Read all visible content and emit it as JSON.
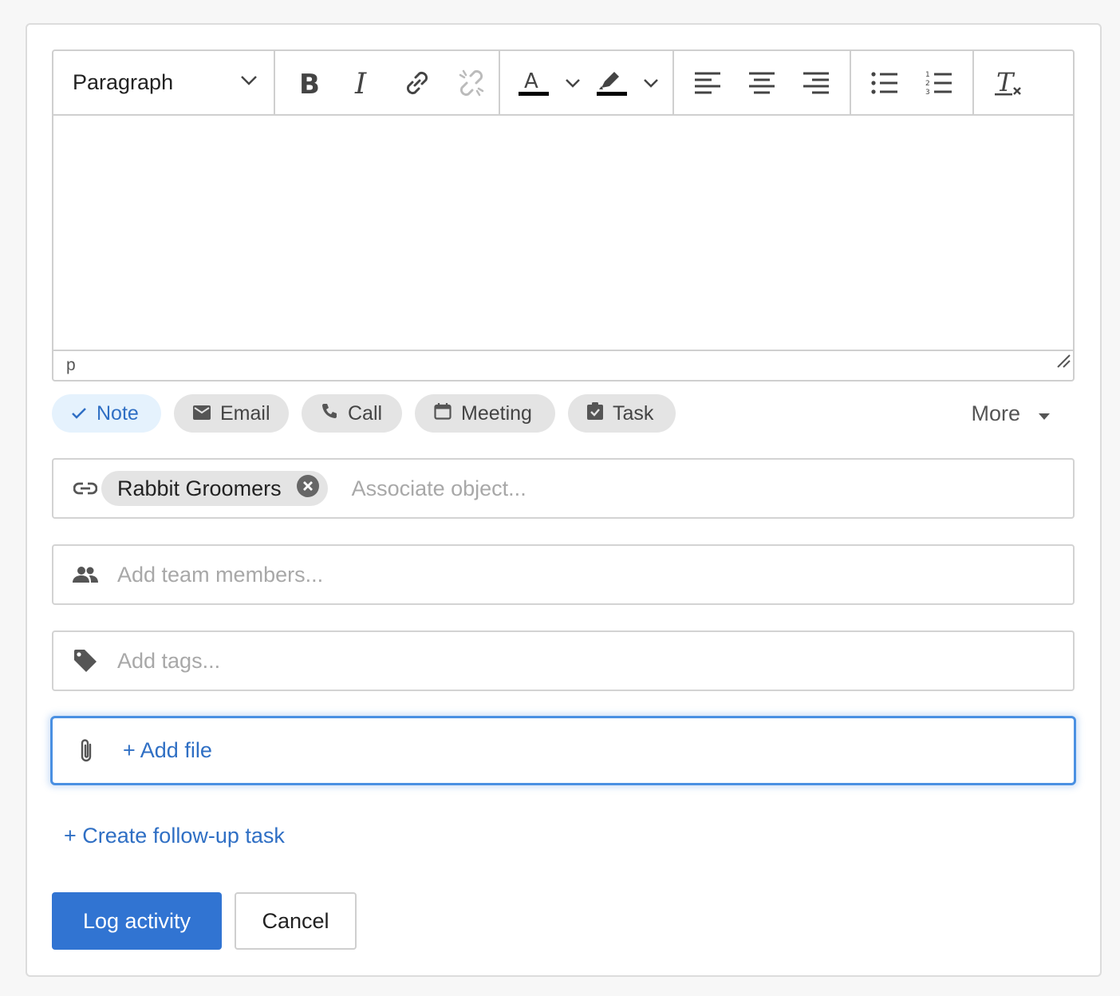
{
  "editor": {
    "block_format": "Paragraph",
    "status_path": "p",
    "content": ""
  },
  "activity_types": {
    "items": [
      {
        "label": "Note",
        "icon": "check-icon",
        "active": true
      },
      {
        "label": "Email",
        "icon": "envelope-icon",
        "active": false
      },
      {
        "label": "Call",
        "icon": "phone-icon",
        "active": false
      },
      {
        "label": "Meeting",
        "icon": "calendar-icon",
        "active": false
      },
      {
        "label": "Task",
        "icon": "clipboard-check-icon",
        "active": false
      }
    ],
    "more_label": "More"
  },
  "associations": {
    "chip_label": "Rabbit Groomers",
    "placeholder": "Associate object..."
  },
  "team": {
    "placeholder": "Add team members..."
  },
  "tags": {
    "placeholder": "Add tags..."
  },
  "files": {
    "add_label": "+ Add file"
  },
  "followup": {
    "label": "+ Create follow-up task"
  },
  "actions": {
    "primary_label": "Log activity",
    "cancel_label": "Cancel"
  },
  "colors": {
    "accent": "#3174d2",
    "link": "#2f6fc4",
    "focus_border": "#4a90e2",
    "chip_bg": "#e4e4e4",
    "active_chip_bg": "#e5f2fd"
  }
}
